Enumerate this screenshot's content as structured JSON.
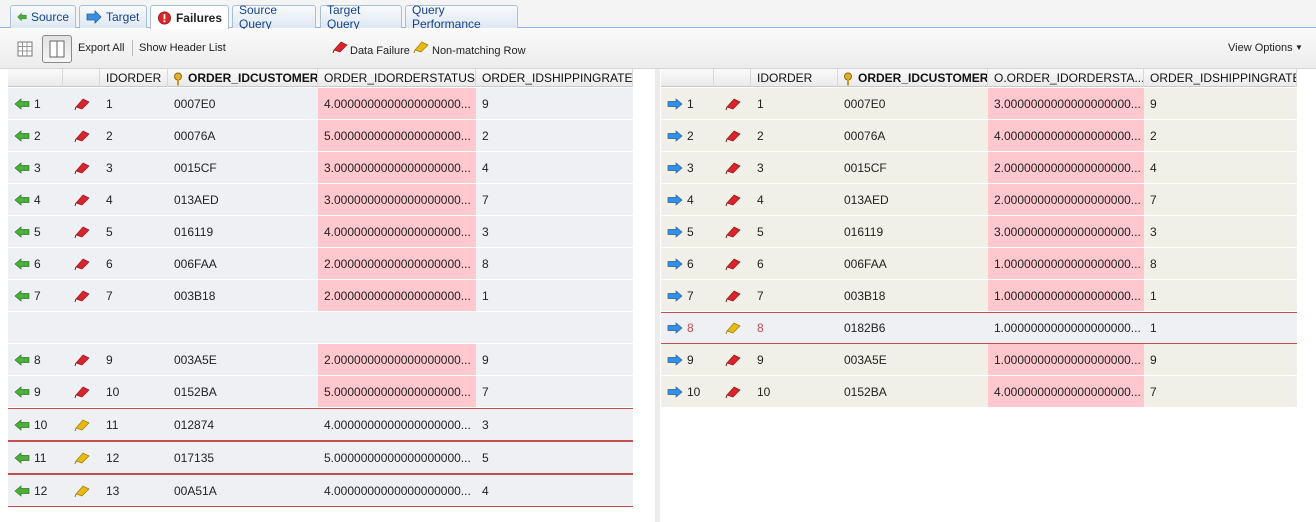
{
  "tabs": [
    {
      "label": "Source",
      "icon": "arrow-left-green-icon",
      "active": false
    },
    {
      "label": "Target",
      "icon": "arrow-right-blue-icon",
      "active": false
    },
    {
      "label": "Failures",
      "icon": "error-circle-icon",
      "active": true
    },
    {
      "label": "Source Query",
      "icon": "",
      "active": false
    },
    {
      "label": "Target Query",
      "icon": "",
      "active": false
    },
    {
      "label": "Query Performance",
      "icon": "",
      "active": false
    }
  ],
  "toolbar": {
    "export_all": "Export All",
    "show_header_list": "Show Header List",
    "legend_data_failure": "Data Failure",
    "legend_non_matching": "Non-matching Row",
    "view_options": "View Options"
  },
  "left_grid": {
    "columns": [
      "IDORDER",
      "ORDER_IDCUSTOMER",
      "ORDER_IDORDERSTATUS",
      "ORDER_IDSHIPPINGRATE"
    ],
    "rows": [
      {
        "num": "1",
        "kind": "data",
        "idorder": "1",
        "customer": "0007E0",
        "status": "4.0000000000000000000...",
        "shipping": "9",
        "fail": true
      },
      {
        "num": "2",
        "kind": "data",
        "idorder": "2",
        "customer": "00076A",
        "status": "5.0000000000000000000...",
        "shipping": "2",
        "fail": true
      },
      {
        "num": "3",
        "kind": "data",
        "idorder": "3",
        "customer": "0015CF",
        "status": "3.0000000000000000000...",
        "shipping": "4",
        "fail": true
      },
      {
        "num": "4",
        "kind": "data",
        "idorder": "4",
        "customer": "013AED",
        "status": "3.0000000000000000000...",
        "shipping": "7",
        "fail": true
      },
      {
        "num": "5",
        "kind": "data",
        "idorder": "5",
        "customer": "016119",
        "status": "4.0000000000000000000...",
        "shipping": "3",
        "fail": true
      },
      {
        "num": "6",
        "kind": "data",
        "idorder": "6",
        "customer": "006FAA",
        "status": "2.0000000000000000000...",
        "shipping": "8",
        "fail": true
      },
      {
        "num": "7",
        "kind": "data",
        "idorder": "7",
        "customer": "003B18",
        "status": "2.0000000000000000000...",
        "shipping": "1",
        "fail": true
      },
      {
        "num": "",
        "kind": "gap",
        "idorder": "",
        "customer": "",
        "status": "",
        "shipping": "",
        "fail": false
      },
      {
        "num": "8",
        "kind": "data",
        "idorder": "9",
        "customer": "003A5E",
        "status": "2.0000000000000000000...",
        "shipping": "9",
        "fail": true
      },
      {
        "num": "9",
        "kind": "data",
        "idorder": "10",
        "customer": "0152BA",
        "status": "5.0000000000000000000...",
        "shipping": "7",
        "fail": true
      },
      {
        "num": "10",
        "kind": "nomatch",
        "idorder": "11",
        "customer": "012874",
        "status": "4.0000000000000000000...",
        "shipping": "3",
        "fail": false
      },
      {
        "num": "11",
        "kind": "nomatch",
        "idorder": "12",
        "customer": "017135",
        "status": "5.0000000000000000000...",
        "shipping": "5",
        "fail": false
      },
      {
        "num": "12",
        "kind": "nomatch",
        "idorder": "13",
        "customer": "00A51A",
        "status": "4.0000000000000000000...",
        "shipping": "4",
        "fail": false
      }
    ]
  },
  "right_grid": {
    "columns": [
      "IDORDER",
      "ORDER_IDCUSTOMER",
      "O.ORDER_IDORDERSTA...",
      "ORDER_IDSHIPPINGRATE"
    ],
    "rows": [
      {
        "num": "1",
        "kind": "data",
        "idorder": "1",
        "customer": "0007E0",
        "status": "3.0000000000000000000...",
        "shipping": "9",
        "fail": true
      },
      {
        "num": "2",
        "kind": "data",
        "idorder": "2",
        "customer": "00076A",
        "status": "4.0000000000000000000...",
        "shipping": "2",
        "fail": true
      },
      {
        "num": "3",
        "kind": "data",
        "idorder": "3",
        "customer": "0015CF",
        "status": "2.0000000000000000000...",
        "shipping": "4",
        "fail": true
      },
      {
        "num": "4",
        "kind": "data",
        "idorder": "4",
        "customer": "013AED",
        "status": "2.0000000000000000000...",
        "shipping": "7",
        "fail": true
      },
      {
        "num": "5",
        "kind": "data",
        "idorder": "5",
        "customer": "016119",
        "status": "3.0000000000000000000...",
        "shipping": "3",
        "fail": true
      },
      {
        "num": "6",
        "kind": "data",
        "idorder": "6",
        "customer": "006FAA",
        "status": "1.0000000000000000000...",
        "shipping": "8",
        "fail": true
      },
      {
        "num": "7",
        "kind": "data",
        "idorder": "7",
        "customer": "003B18",
        "status": "1.0000000000000000000...",
        "shipping": "1",
        "fail": true
      },
      {
        "num": "8",
        "kind": "nomatch",
        "idorder": "8",
        "customer": "0182B6",
        "status": "1.0000000000000000000...",
        "shipping": "1",
        "fail": false
      },
      {
        "num": "9",
        "kind": "data",
        "idorder": "9",
        "customer": "003A5E",
        "status": "1.0000000000000000000...",
        "shipping": "9",
        "fail": true
      },
      {
        "num": "10",
        "kind": "data",
        "idorder": "10",
        "customer": "0152BA",
        "status": "4.0000000000000000000...",
        "shipping": "7",
        "fail": true
      }
    ]
  },
  "colors": {
    "fail_cell": "#ffc7ce",
    "nomatch_border": "#c0504d",
    "accent_green": "#4caf3c",
    "accent_blue": "#3a8ee0",
    "flag_red": "#d9262b",
    "flag_yellow": "#e8b813"
  }
}
